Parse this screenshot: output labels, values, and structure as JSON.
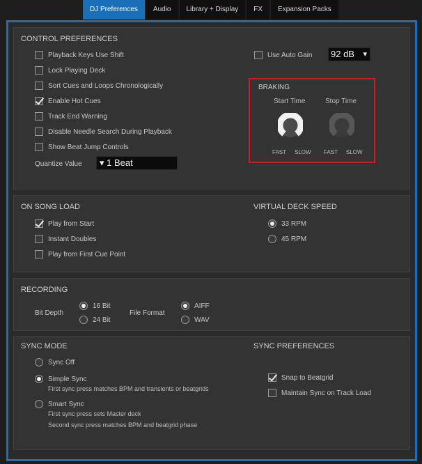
{
  "tabs": [
    {
      "label": "DJ Preferences"
    },
    {
      "label": "Audio"
    },
    {
      "label": "Library + Display"
    },
    {
      "label": "FX"
    },
    {
      "label": "Expansion Packs"
    }
  ],
  "control": {
    "title": "CONTROL PREFERENCES",
    "options": [
      {
        "label": "Playback Keys Use Shift",
        "checked": false
      },
      {
        "label": "Lock Playing Deck",
        "checked": false
      },
      {
        "label": "Sort Cues and Loops Chronologically",
        "checked": false
      },
      {
        "label": "Enable Hot Cues",
        "checked": true
      },
      {
        "label": "Track End Warning",
        "checked": false
      },
      {
        "label": "Disable Needle Search During Playback",
        "checked": false
      },
      {
        "label": "Show Beat Jump Controls",
        "checked": false
      }
    ],
    "quantize_label": "Quantize Value",
    "quantize_value": "▾ 1 Beat",
    "auto_gain_label": "Use Auto Gain",
    "auto_gain_checked": false,
    "gain_value": "92 dB",
    "gain_arrow": "▾",
    "braking": {
      "title": "BRAKING",
      "start_label": "Start Time",
      "stop_label": "Stop Time",
      "fast_label": "FAST",
      "slow_label": "SLOW"
    }
  },
  "song_load": {
    "title": "ON SONG LOAD",
    "options": [
      {
        "label": "Play from Start",
        "checked": true
      },
      {
        "label": "Instant Doubles",
        "checked": false
      },
      {
        "label": "Play from First Cue Point",
        "checked": false
      }
    ]
  },
  "vds": {
    "title": "VIRTUAL DECK SPEED",
    "options": [
      {
        "label": "33 RPM",
        "selected": true
      },
      {
        "label": "45 RPM",
        "selected": false
      }
    ]
  },
  "recording": {
    "title": "RECORDING",
    "bit_depth_label": "Bit Depth",
    "bit_options": [
      {
        "label": "16 Bit",
        "selected": true
      },
      {
        "label": "24 Bit",
        "selected": false
      }
    ],
    "format_label": "File Format",
    "format_options": [
      {
        "label": "AIFF",
        "selected": true
      },
      {
        "label": "WAV",
        "selected": false
      }
    ]
  },
  "sync": {
    "title": "SYNC MODE",
    "options": [
      {
        "label": "Sync Off",
        "selected": false
      },
      {
        "label": "Simple Sync",
        "selected": true
      },
      {
        "label": "Smart Sync",
        "selected": false
      }
    ],
    "simple_desc": "First sync press matches BPM and transients or beatgrids",
    "smart_desc_1": "First sync press sets Master deck",
    "smart_desc_2": "Second sync press matches BPM and beatgrid phase"
  },
  "sync_prefs": {
    "title": "SYNC PREFERENCES",
    "options": [
      {
        "label": "Snap to Beatgrid",
        "checked": true
      },
      {
        "label": "Maintain Sync on Track Load",
        "checked": false
      }
    ]
  },
  "colors": {
    "accent": "#1b6fb8",
    "highlight": "#e0131a"
  },
  "icons": {
    "knob": "knob-icon",
    "dropdown": "chevron-down-icon"
  }
}
